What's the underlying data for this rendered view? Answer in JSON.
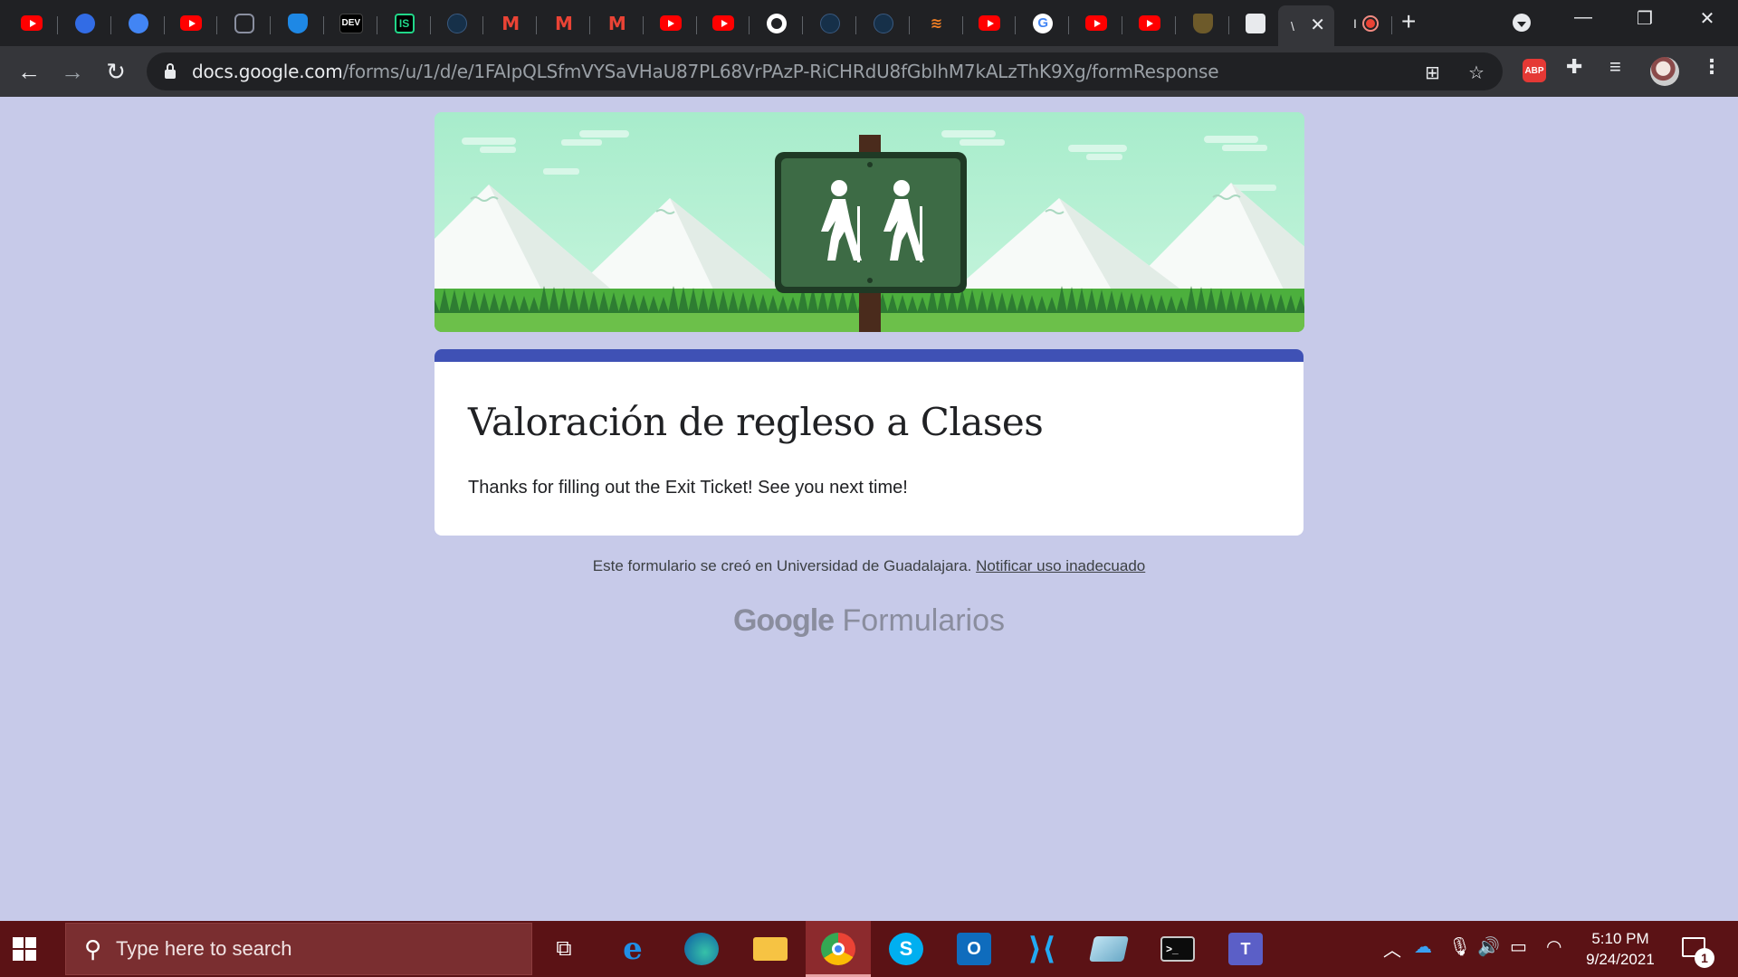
{
  "browser": {
    "tabs": [
      {
        "icon": "youtube-icon"
      },
      {
        "icon": "kubernetes-icon"
      },
      {
        "icon": "google-docs-icon"
      },
      {
        "icon": "youtube-icon"
      },
      {
        "icon": "hexagon-icon"
      },
      {
        "icon": "shield-icon"
      },
      {
        "icon": "dev-icon",
        "text": "DEV"
      },
      {
        "icon": "intellij-icon",
        "text": "IS"
      },
      {
        "icon": "bird-icon"
      },
      {
        "icon": "gmail-icon",
        "text": "M"
      },
      {
        "icon": "gmail-icon",
        "text": "M"
      },
      {
        "icon": "gmail-icon",
        "text": "M"
      },
      {
        "icon": "youtube-icon"
      },
      {
        "icon": "youtube-icon"
      },
      {
        "icon": "github-icon"
      },
      {
        "icon": "bird-icon"
      },
      {
        "icon": "bird-icon"
      },
      {
        "icon": "stackoverflow-icon",
        "text": "≋"
      },
      {
        "icon": "youtube-icon"
      },
      {
        "icon": "google-icon",
        "text": "G"
      },
      {
        "icon": "youtube-icon"
      },
      {
        "icon": "youtube-icon"
      },
      {
        "icon": "crest-icon"
      },
      {
        "icon": "contact-icon"
      }
    ],
    "active_tab_label": "\\",
    "after_active_label": "I",
    "url_host": "docs.google.com",
    "url_path": "/forms/u/1/d/e/1FAIpQLSfmVYSaVHaU87PL68VrPAzP-RiCHRdU8fGbIhM7kALzThK9Xg/formResponse",
    "extension_abp": "ABP"
  },
  "form": {
    "title": "Valoración de regleso a Clases",
    "confirmation": "Thanks for filling out the Exit Ticket!  See you next time!",
    "footer_text": "Este formulario se creó en Universidad de Guadalajara.",
    "footer_link": "Notificar uso inadecuado",
    "brand_google": "Google",
    "brand_product": "Formularios",
    "accent_color": "#3f51b5",
    "page_background": "#c7cae9"
  },
  "taskbar": {
    "search_placeholder": "Type here to search",
    "time": "5:10 PM",
    "date": "9/24/2021",
    "notification_count": "1"
  }
}
